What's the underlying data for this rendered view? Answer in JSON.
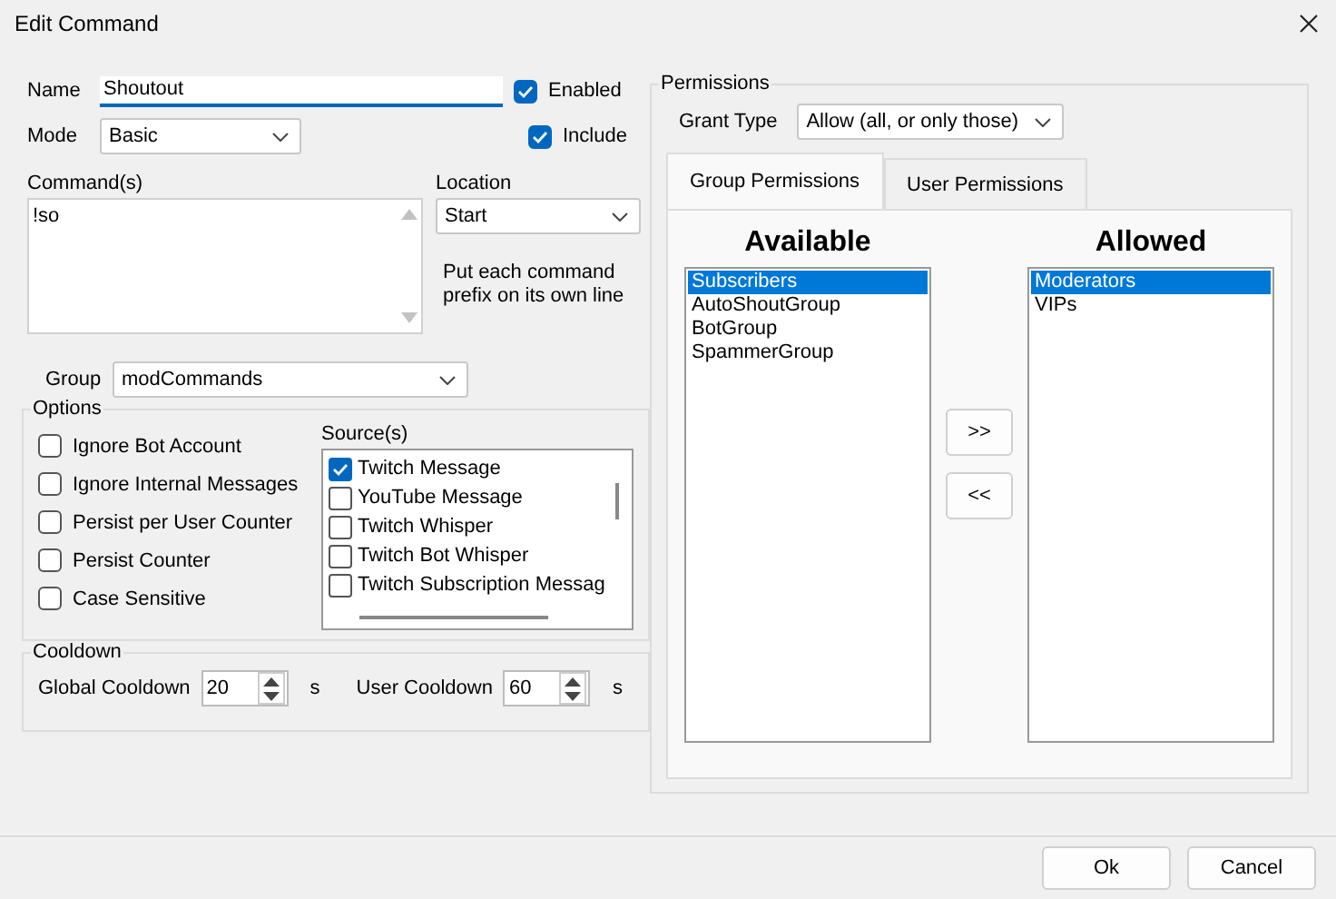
{
  "window": {
    "title": "Edit Command"
  },
  "name": {
    "label": "Name",
    "value": "Shoutout"
  },
  "enabled": {
    "label": "Enabled",
    "checked": true
  },
  "mode": {
    "label": "Mode",
    "value": "Basic"
  },
  "include": {
    "label": "Include",
    "checked": true
  },
  "commands": {
    "label": "Command(s)",
    "value": "!so"
  },
  "location": {
    "label": "Location",
    "value": "Start",
    "hint": "Put each command prefix on its own line"
  },
  "group": {
    "label": "Group",
    "value": "modCommands"
  },
  "options": {
    "title": "Options",
    "items": [
      {
        "label": "Ignore Bot Account",
        "checked": false
      },
      {
        "label": "Ignore Internal Messages",
        "checked": false
      },
      {
        "label": "Persist per User Counter",
        "checked": false
      },
      {
        "label": "Persist Counter",
        "checked": false
      },
      {
        "label": "Case Sensitive",
        "checked": false
      }
    ]
  },
  "sources": {
    "label": "Source(s)",
    "items": [
      {
        "label": "Twitch Message",
        "checked": true
      },
      {
        "label": "YouTube Message",
        "checked": false
      },
      {
        "label": "Twitch Whisper",
        "checked": false
      },
      {
        "label": "Twitch Bot Whisper",
        "checked": false
      },
      {
        "label": "Twitch Subscription Messag",
        "checked": false
      }
    ]
  },
  "cooldown": {
    "title": "Cooldown",
    "fields": [
      {
        "label": "Global Cooldown",
        "value": "20",
        "unit": "s"
      },
      {
        "label": "User Cooldown",
        "value": "60",
        "unit": "s"
      }
    ]
  },
  "permissions": {
    "title": "Permissions",
    "grant_type": {
      "label": "Grant Type",
      "value": "Allow (all, or only those)"
    },
    "tabs": [
      {
        "label": "Group Permissions",
        "selected": true
      },
      {
        "label": "User Permissions",
        "selected": false
      }
    ],
    "available": {
      "title": "Available",
      "items": [
        {
          "label": "Subscribers",
          "selected": true
        },
        {
          "label": "AutoShoutGroup",
          "selected": false
        },
        {
          "label": "BotGroup",
          "selected": false
        },
        {
          "label": "SpammerGroup",
          "selected": false
        }
      ]
    },
    "move_buttons": [
      ">>",
      "<<"
    ],
    "allowed": {
      "title": "Allowed",
      "items": [
        {
          "label": "Moderators",
          "selected": true
        },
        {
          "label": "VIPs",
          "selected": false
        }
      ]
    }
  },
  "buttons": [
    "Ok",
    "Cancel"
  ]
}
